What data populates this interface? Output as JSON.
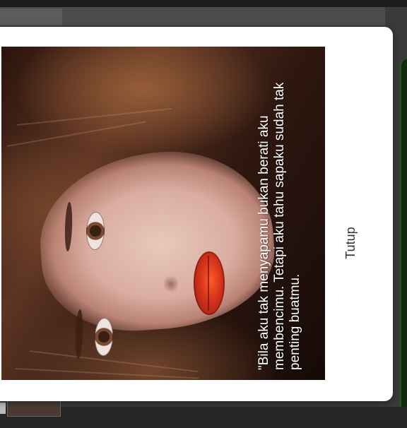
{
  "dialog": {
    "image": {
      "caption": "\"Bila aku tak menyapamu bukan berati aku membencimu. Tetapi aku tahu sapaku sudah tak penting buatmu."
    },
    "close_label": "Tutup"
  },
  "colors": {
    "overlay_bg": "#3a3a3a",
    "dialog_bg": "#ffffff",
    "close_text": "#333333",
    "accent_green": "#1f5a1f"
  },
  "icons": {
    "thumb": "image-thumbnail-icon"
  }
}
